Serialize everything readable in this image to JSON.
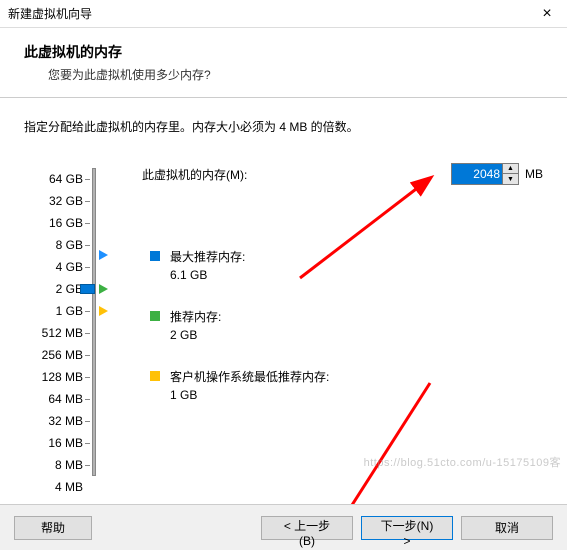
{
  "titlebar": {
    "title": "新建虚拟机向导",
    "close": "×"
  },
  "header": {
    "title": "此虚拟机的内存",
    "subtitle": "您要为此虚拟机使用多少内存?"
  },
  "instruction": "指定分配给此虚拟机的内存里。内存大小必须为 4 MB 的倍数。",
  "memory": {
    "label": "此虚拟机的内存(M):",
    "value": "2048",
    "unit": "MB",
    "up": "▲",
    "down": "▼"
  },
  "scale": [
    "64 GB",
    "32 GB",
    "16 GB",
    "8 GB",
    "4 GB",
    "2 GB",
    "1 GB",
    "512 MB",
    "256 MB",
    "128 MB",
    "64 MB",
    "32 MB",
    "16 MB",
    "8 MB",
    "4 MB"
  ],
  "info": {
    "max": {
      "label": "最大推荐内存:",
      "value": "6.1 GB"
    },
    "rec": {
      "label": "推荐内存:",
      "value": "2 GB"
    },
    "min": {
      "label": "客户机操作系统最低推荐内存:",
      "value": "1 GB"
    }
  },
  "footer": {
    "help": "帮助",
    "back": "< 上一步(B)",
    "next": "下一步(N) >",
    "cancel": "取消"
  },
  "watermark": "https://blog.51cto.com/u-15175109客"
}
